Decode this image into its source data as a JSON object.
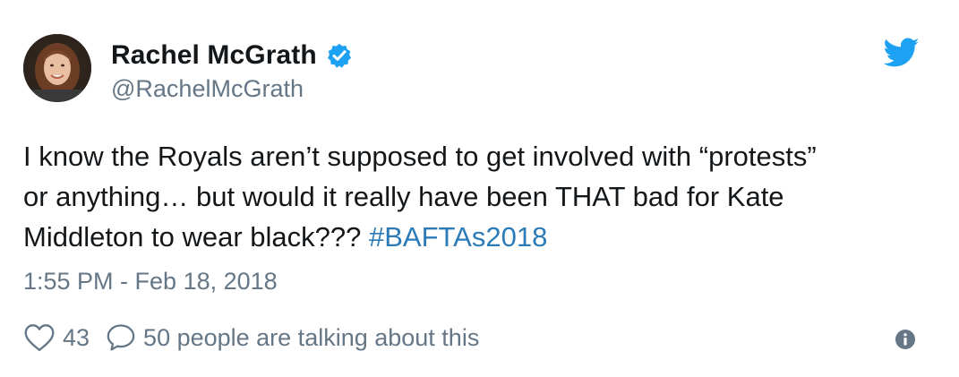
{
  "author": {
    "name": "Rachel McGrath",
    "handle": "@RachelMcGrath",
    "verified": true,
    "avatar_icon": "avatar-photo"
  },
  "tweet": {
    "text_line1": "I know the Royals aren’t supposed to get involved with “protests”",
    "text_line2": "or anything… but would it really have been THAT bad for Kate",
    "text_line3": "Middleton to wear black??? ",
    "hashtag": "#BAFTAs2018",
    "timestamp": "1:55 PM - Feb 18, 2018"
  },
  "actions": {
    "like_icon": "heart-icon",
    "like_count": "43",
    "reply_icon": "speech-bubble-icon",
    "talking_label": "50 people are talking about this",
    "info_icon": "info-icon"
  },
  "branding": {
    "logo_icon": "twitter-bird-icon"
  },
  "colors": {
    "text": "#14171a",
    "secondary": "#657786",
    "link": "#2b7bb9",
    "twitter_blue": "#1da1f2"
  }
}
